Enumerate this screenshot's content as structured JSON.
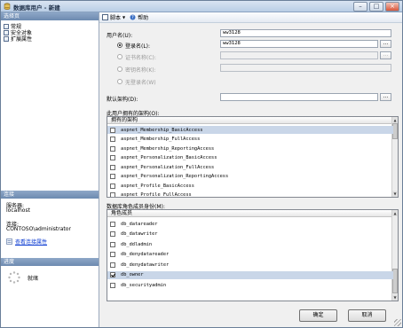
{
  "window": {
    "title": "数据库用户 - 新建"
  },
  "left": {
    "pages_header": "选择页",
    "pages": [
      "常规",
      "安全对象",
      "扩展属性"
    ],
    "connection_header": "连接",
    "server_label": "服务器:",
    "server_value": "localhost",
    "connect_label": "连接:",
    "connect_value": "CONTOSO\\administrator",
    "view_conn_link": "查看连接属性",
    "progress_header": "进度",
    "progress_status": "就绪"
  },
  "toolbar": {
    "script_label": "脚本",
    "help_label": "帮助"
  },
  "form": {
    "username_label": "用户名(U):",
    "username_value": "ww3128",
    "login_label": "登录名(L):",
    "login_value": "ww3128",
    "cert_label": "证书名称(C):",
    "key_label": "密钥名称(K):",
    "nologin_label": "无登录名(W)",
    "default_schema_label": "默认架构(D):",
    "browse_label": "..."
  },
  "schemas": {
    "section_label": "此用户拥有的架构(O):",
    "column": "拥有的架构",
    "rows": [
      "aspnet_Membership_BasicAccess",
      "aspnet_Membership_FullAccess",
      "aspnet_Membership_ReportingAccess",
      "aspnet_Personalization_BasicAccess",
      "aspnet_Personalization_FullAccess",
      "aspnet_Personalization_ReportingAccess",
      "aspnet_Profile_BasicAccess",
      "aspnet_Profile_FullAccess"
    ]
  },
  "roles": {
    "section_label": "数据库角色成员身份(M):",
    "column": "角色成员",
    "rows": [
      {
        "name": "db_datareader",
        "checked": false
      },
      {
        "name": "db_datawriter",
        "checked": false
      },
      {
        "name": "db_ddladmin",
        "checked": false
      },
      {
        "name": "db_denydatareader",
        "checked": false
      },
      {
        "name": "db_denydatawriter",
        "checked": false
      },
      {
        "name": "db_owner",
        "checked": true
      },
      {
        "name": "db_securityadmin",
        "checked": false
      }
    ]
  },
  "buttons": {
    "ok": "确定",
    "cancel": "取消"
  }
}
